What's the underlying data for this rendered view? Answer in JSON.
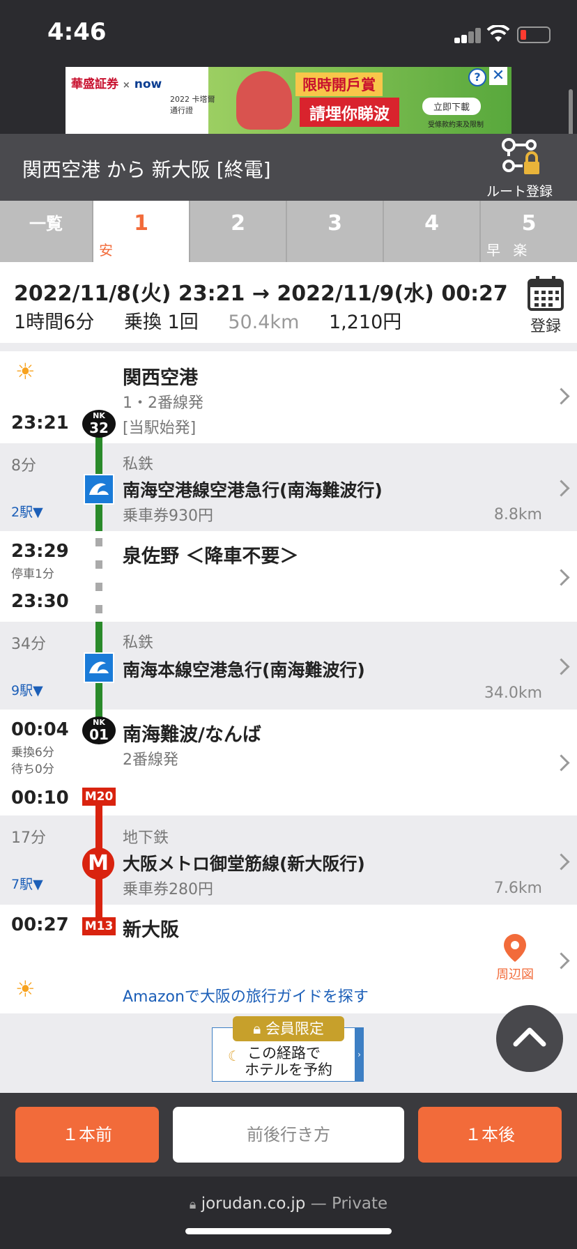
{
  "status": {
    "time": "4:46"
  },
  "ad": {
    "brand1": "華盛証券",
    "cross": "×",
    "brand2": "now",
    "sub": "2022 卡塔爾 通行證",
    "headline1": "限時開戶賞",
    "headline2": "請埋你睇波",
    "cta": "立即下載",
    "note": "受條款約束及限制",
    "help": "?",
    "close": "✕"
  },
  "header": {
    "title": "関西空港 から 新大阪 [終電]",
    "route_register": "ルート登録"
  },
  "tabs": [
    {
      "label": "一覧",
      "badge": ""
    },
    {
      "label": "1",
      "badge": "安"
    },
    {
      "label": "2",
      "badge": ""
    },
    {
      "label": "3",
      "badge": ""
    },
    {
      "label": "4",
      "badge": ""
    },
    {
      "label": "5",
      "badge": "早 楽"
    }
  ],
  "summary": {
    "datetime": "2022/11/8(火)  23:21 → 2022/11/9(水)  00:27",
    "duration": "1時間6分",
    "transfers": "乗換 1回",
    "distance": "50.4km",
    "fare": "1,210円",
    "register": "登録"
  },
  "timeline": {
    "s1": {
      "time": "23:21",
      "name": "関西空港",
      "platform": "1・2番線発",
      "note": "[当駅始発]",
      "code_a": "NK",
      "code_b": "32"
    },
    "seg1": {
      "duration": "8分",
      "stops": "2駅▼",
      "type": "私鉄",
      "line": "南海空港線空港急行(南海難波行)",
      "ticket": "乗車券930円",
      "distance": "8.8km"
    },
    "s2": {
      "arr": "23:29",
      "stop": "停車1分",
      "dep": "23:30",
      "name": "泉佐野 ＜降車不要＞"
    },
    "seg2": {
      "duration": "34分",
      "stops": "9駅▼",
      "type": "私鉄",
      "line": "南海本線空港急行(南海難波行)",
      "distance": "34.0km"
    },
    "s3": {
      "arr": "00:04",
      "transfer": "乗換6分",
      "wait": "待ち0分",
      "dep": "00:10",
      "name": "南海難波/なんば",
      "platform": "2番線発",
      "code_a": "NK",
      "code_b": "01",
      "metro_code": "M20"
    },
    "seg3": {
      "duration": "17分",
      "stops": "7駅▼",
      "type": "地下鉄",
      "line": "大阪メトロ御堂筋線(新大阪行)",
      "ticket": "乗車券280円",
      "distance": "7.6km",
      "logo": "M"
    },
    "s4": {
      "time": "00:27",
      "name": "新大阪",
      "code": "M13",
      "map": "周辺図",
      "amazon": "Amazonで大阪の旅行ガイドを探す"
    }
  },
  "hotel": {
    "badge": "会員限定",
    "text1": "この経路で",
    "text2": "ホテルを予約"
  },
  "bottom": {
    "prev": "１本前",
    "around": "前後行き方",
    "next": "１本後"
  },
  "browser": {
    "domain": "jorudan.co.jp",
    "private": " — Private"
  },
  "colors": {
    "accent": "#f26b3a",
    "nankai_green": "#2a8a2a",
    "metro_red": "#d9230f",
    "link_blue": "#1c5fb8"
  }
}
